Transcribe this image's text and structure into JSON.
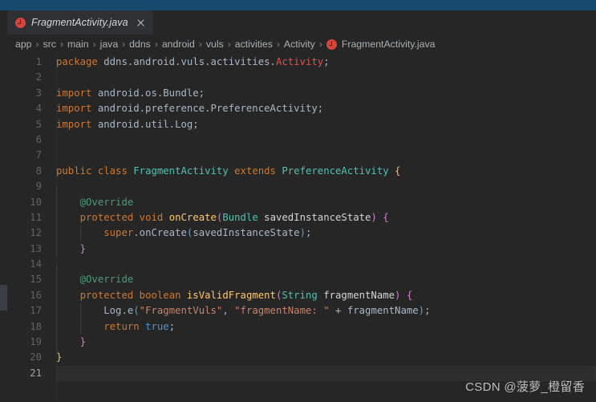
{
  "window": {
    "accent_color": "#17496e",
    "background_color": "#262626"
  },
  "tab": {
    "title": "FragmentActivity.java",
    "file_icon": "java-class-icon",
    "close_icon": "close-icon"
  },
  "breadcrumb": {
    "separator": "›",
    "items": [
      "app",
      "src",
      "main",
      "java",
      "ddns",
      "android",
      "vuls",
      "activities",
      "Activity"
    ],
    "file": "FragmentActivity.java",
    "file_icon": "java-class-icon"
  },
  "editor": {
    "language": "java",
    "current_line": 21,
    "total_lines": 21,
    "lines": [
      {
        "n": 1,
        "indent": 0,
        "tokens": [
          {
            "t": "package",
            "c": "kw"
          },
          {
            "t": " ",
            "c": "plain"
          },
          {
            "t": "ddns.android.vuls.activities.",
            "c": "plain"
          },
          {
            "t": "Activity",
            "c": "err"
          },
          {
            "t": ";",
            "c": "punct"
          }
        ]
      },
      {
        "n": 2,
        "indent": 0,
        "tokens": []
      },
      {
        "n": 3,
        "indent": 0,
        "tokens": [
          {
            "t": "import",
            "c": "kw"
          },
          {
            "t": " android.os.Bundle;",
            "c": "plain"
          }
        ]
      },
      {
        "n": 4,
        "indent": 0,
        "tokens": [
          {
            "t": "import",
            "c": "kw"
          },
          {
            "t": " android.preference.PreferenceActivity;",
            "c": "plain"
          }
        ]
      },
      {
        "n": 5,
        "indent": 0,
        "tokens": [
          {
            "t": "import",
            "c": "kw"
          },
          {
            "t": " android.util.Log;",
            "c": "plain"
          }
        ]
      },
      {
        "n": 6,
        "indent": 0,
        "tokens": []
      },
      {
        "n": 7,
        "indent": 0,
        "tokens": []
      },
      {
        "n": 8,
        "indent": 0,
        "tokens": [
          {
            "t": "public",
            "c": "kw"
          },
          {
            "t": " ",
            "c": "plain"
          },
          {
            "t": "class",
            "c": "kw"
          },
          {
            "t": " ",
            "c": "plain"
          },
          {
            "t": "FragmentActivity",
            "c": "type"
          },
          {
            "t": " ",
            "c": "plain"
          },
          {
            "t": "extends",
            "c": "kw"
          },
          {
            "t": " ",
            "c": "plain"
          },
          {
            "t": "PreferenceActivity",
            "c": "type"
          },
          {
            "t": " ",
            "c": "plain"
          },
          {
            "t": "{",
            "c": "brace-y"
          }
        ]
      },
      {
        "n": 9,
        "indent": 1,
        "tokens": []
      },
      {
        "n": 10,
        "indent": 1,
        "tokens": [
          {
            "t": "    ",
            "c": "plain"
          },
          {
            "t": "@Override",
            "c": "ann"
          }
        ]
      },
      {
        "n": 11,
        "indent": 1,
        "tokens": [
          {
            "t": "    ",
            "c": "plain"
          },
          {
            "t": "protected",
            "c": "kw"
          },
          {
            "t": " ",
            "c": "plain"
          },
          {
            "t": "void",
            "c": "kw"
          },
          {
            "t": " ",
            "c": "plain"
          },
          {
            "t": "onCreate",
            "c": "fn"
          },
          {
            "t": "(",
            "c": "brace-p"
          },
          {
            "t": "Bundle",
            "c": "type"
          },
          {
            "t": " savedInstanceState",
            "c": "param"
          },
          {
            "t": ")",
            "c": "brace-p"
          },
          {
            "t": " ",
            "c": "plain"
          },
          {
            "t": "{",
            "c": "brace-p"
          }
        ]
      },
      {
        "n": 12,
        "indent": 2,
        "tokens": [
          {
            "t": "        ",
            "c": "plain"
          },
          {
            "t": "super",
            "c": "kw"
          },
          {
            "t": ".onCreate",
            "c": "plain"
          },
          {
            "t": "(",
            "c": "brace-b"
          },
          {
            "t": "savedInstanceState",
            "c": "plain"
          },
          {
            "t": ")",
            "c": "brace-b"
          },
          {
            "t": ";",
            "c": "punct"
          }
        ]
      },
      {
        "n": 13,
        "indent": 1,
        "tokens": [
          {
            "t": "    ",
            "c": "plain"
          },
          {
            "t": "}",
            "c": "brace-p"
          }
        ]
      },
      {
        "n": 14,
        "indent": 1,
        "tokens": []
      },
      {
        "n": 15,
        "indent": 1,
        "tokens": [
          {
            "t": "    ",
            "c": "plain"
          },
          {
            "t": "@Override",
            "c": "ann"
          }
        ]
      },
      {
        "n": 16,
        "indent": 1,
        "tokens": [
          {
            "t": "    ",
            "c": "plain"
          },
          {
            "t": "protected",
            "c": "kw"
          },
          {
            "t": " ",
            "c": "plain"
          },
          {
            "t": "boolean",
            "c": "kw"
          },
          {
            "t": " ",
            "c": "plain"
          },
          {
            "t": "isValidFragment",
            "c": "fn"
          },
          {
            "t": "(",
            "c": "brace-p"
          },
          {
            "t": "String",
            "c": "type"
          },
          {
            "t": " fragmentName",
            "c": "param"
          },
          {
            "t": ")",
            "c": "brace-p"
          },
          {
            "t": " ",
            "c": "plain"
          },
          {
            "t": "{",
            "c": "brace-p"
          }
        ]
      },
      {
        "n": 17,
        "indent": 2,
        "tokens": [
          {
            "t": "        ",
            "c": "plain"
          },
          {
            "t": "Log",
            "c": "plain"
          },
          {
            "t": ".e",
            "c": "plain"
          },
          {
            "t": "(",
            "c": "brace-b"
          },
          {
            "t": "\"FragmentVuls\"",
            "c": "str"
          },
          {
            "t": ", ",
            "c": "punct"
          },
          {
            "t": "\"fragmentName: \"",
            "c": "str"
          },
          {
            "t": " + ",
            "c": "punct"
          },
          {
            "t": "fragmentName",
            "c": "plain"
          },
          {
            "t": ")",
            "c": "brace-b"
          },
          {
            "t": ";",
            "c": "punct"
          }
        ]
      },
      {
        "n": 18,
        "indent": 2,
        "tokens": [
          {
            "t": "        ",
            "c": "plain"
          },
          {
            "t": "return",
            "c": "kw"
          },
          {
            "t": " ",
            "c": "plain"
          },
          {
            "t": "true",
            "c": "kw2"
          },
          {
            "t": ";",
            "c": "punct"
          }
        ]
      },
      {
        "n": 19,
        "indent": 1,
        "tokens": [
          {
            "t": "    ",
            "c": "plain"
          },
          {
            "t": "}",
            "c": "brace-p"
          }
        ]
      },
      {
        "n": 20,
        "indent": 0,
        "tokens": [
          {
            "t": "}",
            "c": "brace-y"
          }
        ]
      },
      {
        "n": 21,
        "indent": 0,
        "tokens": []
      }
    ]
  },
  "watermark": {
    "text": "CSDN @菠萝_橙留香"
  }
}
